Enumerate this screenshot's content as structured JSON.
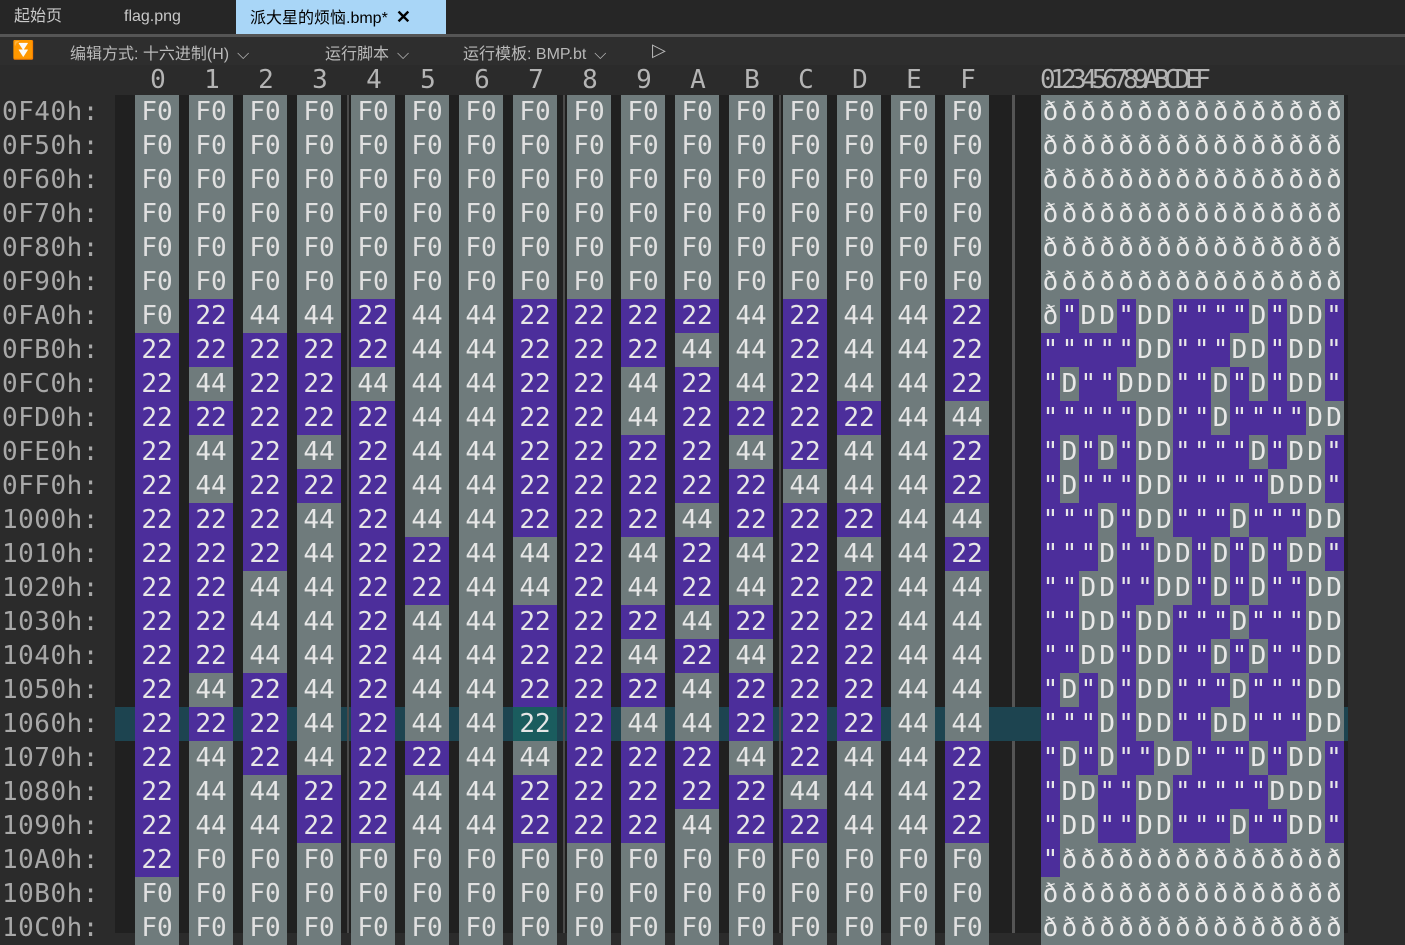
{
  "tabs": [
    {
      "label": "起始页"
    },
    {
      "label": "flag.png"
    },
    {
      "label": "派大星的烦恼.bmp*"
    }
  ],
  "toolbar": {
    "edit_mode": "编辑方式: 十六进制(H)",
    "run_script": "运行脚本",
    "run_template": "运行模板: BMP.bt"
  },
  "column_headers": [
    "0",
    "1",
    "2",
    "3",
    "4",
    "5",
    "6",
    "7",
    "8",
    "9",
    "A",
    "B",
    "C",
    "D",
    "E",
    "F"
  ],
  "ascii_header": "0123456789ABCDEF",
  "rows": [
    {
      "addr": "0F40h:",
      "bytes": [
        "F0",
        "F0",
        "F0",
        "F0",
        "F0",
        "F0",
        "F0",
        "F0",
        "F0",
        "F0",
        "F0",
        "F0",
        "F0",
        "F0",
        "F0",
        "F0"
      ]
    },
    {
      "addr": "0F50h:",
      "bytes": [
        "F0",
        "F0",
        "F0",
        "F0",
        "F0",
        "F0",
        "F0",
        "F0",
        "F0",
        "F0",
        "F0",
        "F0",
        "F0",
        "F0",
        "F0",
        "F0"
      ]
    },
    {
      "addr": "0F60h:",
      "bytes": [
        "F0",
        "F0",
        "F0",
        "F0",
        "F0",
        "F0",
        "F0",
        "F0",
        "F0",
        "F0",
        "F0",
        "F0",
        "F0",
        "F0",
        "F0",
        "F0"
      ]
    },
    {
      "addr": "0F70h:",
      "bytes": [
        "F0",
        "F0",
        "F0",
        "F0",
        "F0",
        "F0",
        "F0",
        "F0",
        "F0",
        "F0",
        "F0",
        "F0",
        "F0",
        "F0",
        "F0",
        "F0"
      ]
    },
    {
      "addr": "0F80h:",
      "bytes": [
        "F0",
        "F0",
        "F0",
        "F0",
        "F0",
        "F0",
        "F0",
        "F0",
        "F0",
        "F0",
        "F0",
        "F0",
        "F0",
        "F0",
        "F0",
        "F0"
      ]
    },
    {
      "addr": "0F90h:",
      "bytes": [
        "F0",
        "F0",
        "F0",
        "F0",
        "F0",
        "F0",
        "F0",
        "F0",
        "F0",
        "F0",
        "F0",
        "F0",
        "F0",
        "F0",
        "F0",
        "F0"
      ]
    },
    {
      "addr": "0FA0h:",
      "bytes": [
        "F0",
        "22",
        "44",
        "44",
        "22",
        "44",
        "44",
        "22",
        "22",
        "22",
        "22",
        "44",
        "22",
        "44",
        "44",
        "22"
      ]
    },
    {
      "addr": "0FB0h:",
      "bytes": [
        "22",
        "22",
        "22",
        "22",
        "22",
        "44",
        "44",
        "22",
        "22",
        "22",
        "44",
        "44",
        "22",
        "44",
        "44",
        "22"
      ]
    },
    {
      "addr": "0FC0h:",
      "bytes": [
        "22",
        "44",
        "22",
        "22",
        "44",
        "44",
        "44",
        "22",
        "22",
        "44",
        "22",
        "44",
        "22",
        "44",
        "44",
        "22"
      ]
    },
    {
      "addr": "0FD0h:",
      "bytes": [
        "22",
        "22",
        "22",
        "22",
        "22",
        "44",
        "44",
        "22",
        "22",
        "44",
        "22",
        "22",
        "22",
        "22",
        "44",
        "44"
      ]
    },
    {
      "addr": "0FE0h:",
      "bytes": [
        "22",
        "44",
        "22",
        "44",
        "22",
        "44",
        "44",
        "22",
        "22",
        "22",
        "22",
        "44",
        "22",
        "44",
        "44",
        "22"
      ]
    },
    {
      "addr": "0FF0h:",
      "bytes": [
        "22",
        "44",
        "22",
        "22",
        "22",
        "44",
        "44",
        "22",
        "22",
        "22",
        "22",
        "22",
        "44",
        "44",
        "44",
        "22"
      ]
    },
    {
      "addr": "1000h:",
      "bytes": [
        "22",
        "22",
        "22",
        "44",
        "22",
        "44",
        "44",
        "22",
        "22",
        "22",
        "44",
        "22",
        "22",
        "22",
        "44",
        "44"
      ]
    },
    {
      "addr": "1010h:",
      "bytes": [
        "22",
        "22",
        "22",
        "44",
        "22",
        "22",
        "44",
        "44",
        "22",
        "44",
        "22",
        "44",
        "22",
        "44",
        "44",
        "22"
      ]
    },
    {
      "addr": "1020h:",
      "bytes": [
        "22",
        "22",
        "44",
        "44",
        "22",
        "22",
        "44",
        "44",
        "22",
        "44",
        "22",
        "44",
        "22",
        "22",
        "44",
        "44"
      ]
    },
    {
      "addr": "1030h:",
      "bytes": [
        "22",
        "22",
        "44",
        "44",
        "22",
        "44",
        "44",
        "22",
        "22",
        "22",
        "44",
        "22",
        "22",
        "22",
        "44",
        "44"
      ]
    },
    {
      "addr": "1040h:",
      "bytes": [
        "22",
        "22",
        "44",
        "44",
        "22",
        "44",
        "44",
        "22",
        "22",
        "44",
        "22",
        "44",
        "22",
        "22",
        "44",
        "44"
      ]
    },
    {
      "addr": "1050h:",
      "bytes": [
        "22",
        "44",
        "22",
        "44",
        "22",
        "44",
        "44",
        "22",
        "22",
        "22",
        "44",
        "22",
        "22",
        "22",
        "44",
        "44"
      ]
    },
    {
      "addr": "1060h:",
      "bytes": [
        "22",
        "22",
        "22",
        "44",
        "22",
        "44",
        "44",
        "22",
        "22",
        "44",
        "44",
        "22",
        "22",
        "22",
        "44",
        "44"
      ]
    },
    {
      "addr": "1070h:",
      "bytes": [
        "22",
        "44",
        "22",
        "44",
        "22",
        "22",
        "44",
        "44",
        "22",
        "22",
        "22",
        "44",
        "22",
        "44",
        "44",
        "22"
      ]
    },
    {
      "addr": "1080h:",
      "bytes": [
        "22",
        "44",
        "44",
        "22",
        "22",
        "44",
        "44",
        "22",
        "22",
        "22",
        "22",
        "22",
        "44",
        "44",
        "44",
        "22"
      ]
    },
    {
      "addr": "1090h:",
      "bytes": [
        "22",
        "44",
        "44",
        "22",
        "22",
        "44",
        "44",
        "22",
        "22",
        "22",
        "44",
        "22",
        "22",
        "44",
        "44",
        "22"
      ]
    },
    {
      "addr": "10A0h:",
      "bytes": [
        "22",
        "F0",
        "F0",
        "F0",
        "F0",
        "F0",
        "F0",
        "F0",
        "F0",
        "F0",
        "F0",
        "F0",
        "F0",
        "F0",
        "F0",
        "F0"
      ]
    },
    {
      "addr": "10B0h:",
      "bytes": [
        "F0",
        "F0",
        "F0",
        "F0",
        "F0",
        "F0",
        "F0",
        "F0",
        "F0",
        "F0",
        "F0",
        "F0",
        "F0",
        "F0",
        "F0",
        "F0"
      ]
    },
    {
      "addr": "10C0h:",
      "bytes": [
        "F0",
        "F0",
        "F0",
        "F0",
        "F0",
        "F0",
        "F0",
        "F0",
        "F0",
        "F0",
        "F0",
        "F0",
        "F0",
        "F0",
        "F0",
        "F0"
      ]
    }
  ],
  "ascii_map": {
    "F0": "ð",
    "22": "\"",
    "44": "D"
  },
  "selected": {
    "row": 18,
    "col": 7
  },
  "colors": {
    "purple": "#4c2e9b",
    "gray": "#6f7b7c",
    "selection": "#1a5c5e",
    "active_tab": "#a9d6f7"
  }
}
